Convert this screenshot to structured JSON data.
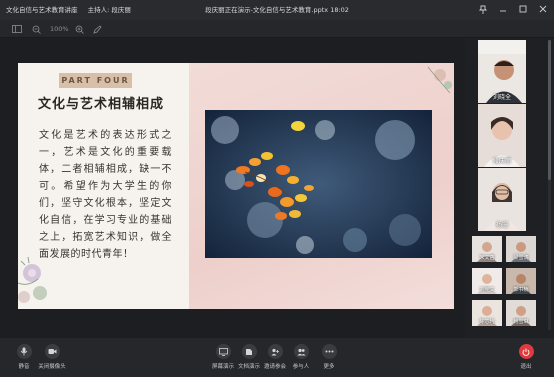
{
  "titlebar": {
    "meeting_title": "文化自信与艺术教育讲座",
    "host": "主持人: 段庆丽",
    "presenting": "段庆丽正在演示-文化自信与艺术教育.pptx 18:02"
  },
  "toolbar": {
    "zoom": "100%"
  },
  "slide": {
    "part_tag": "PART FOUR",
    "title": "文化与艺术相辅相成",
    "body": "文化是艺术的表达形式之一，艺术是文化的重要载体，二者相辅相成，缺一不可。希望作为大学生的你们，坚守文化根本，坚定文化自信，在学习专业的基础之上，拓宽艺术知识，做全面发展的时代青年！"
  },
  "participants": {
    "videos": [
      {
        "name": "刘晓全"
      },
      {
        "name": "段庆丽"
      },
      {
        "name": "杨珊"
      }
    ],
    "thumbs": [
      {
        "name": "宋文菡"
      },
      {
        "name": "梁雪涛"
      },
      {
        "name": "刘宪文"
      },
      {
        "name": "郭书楠"
      },
      {
        "name": "陈芯玙"
      },
      {
        "name": "韩雪琳"
      }
    ]
  },
  "bottombar": {
    "mute": "静音",
    "camera_off": "关闭摄像头",
    "screen_share": "屏幕演示",
    "doc_share": "文档演示",
    "invite": "邀请参会",
    "participants": "参与人",
    "more": "更多",
    "leave": "退出"
  },
  "colors": {
    "leave": "#e0393e",
    "tag": "#d8bfa8"
  }
}
